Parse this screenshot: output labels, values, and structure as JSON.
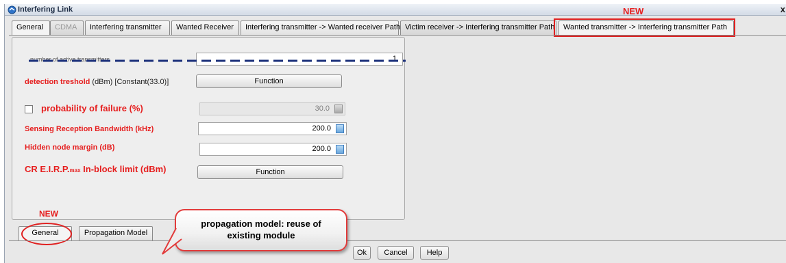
{
  "window": {
    "title": "Interfering Link",
    "close": "x"
  },
  "annotations": {
    "new_top": "NEW",
    "new_bottom": "NEW",
    "callout_line1": "propagation model: reuse of",
    "callout_line2": "existing module"
  },
  "tabs": [
    {
      "label": "General"
    },
    {
      "label": "CDMA"
    },
    {
      "label": "Interfering transmitter"
    },
    {
      "label": "Wanted Receiver"
    },
    {
      "label": "Interfering transmitter -> Wanted receiver Path"
    },
    {
      "label": "Victim receiver -> Interfering transmitter Path"
    },
    {
      "label": "Wanted transmitter -> Interfering transmitter Path"
    }
  ],
  "form": {
    "active_tx": {
      "label": "number of active transmitters",
      "value": "1"
    },
    "detection": {
      "label": "detection treshold",
      "unit": "(dBm) [Constant(33.0)]",
      "button": "Function"
    },
    "failure": {
      "label": "probability of failure (%)",
      "value": "30.0"
    },
    "sensing": {
      "label": "Sensing Reception Bandwidth (kHz)",
      "value": "200.0"
    },
    "hidden": {
      "label": "Hidden node margin (dB)",
      "value": "200.0"
    },
    "eirp": {
      "label_a": "CR E.I.R.P.",
      "label_sub": "max",
      "label_b": " In-block limit (dBm)",
      "button": "Function"
    }
  },
  "bottom_tabs": [
    {
      "label": "General"
    },
    {
      "label": "Propagation Model"
    }
  ],
  "buttons": {
    "ok": "Ok",
    "cancel": "Cancel",
    "help": "Help"
  },
  "colors": {
    "accent_red": "#e61e1e",
    "dashed_line": "#1a2f7a"
  }
}
